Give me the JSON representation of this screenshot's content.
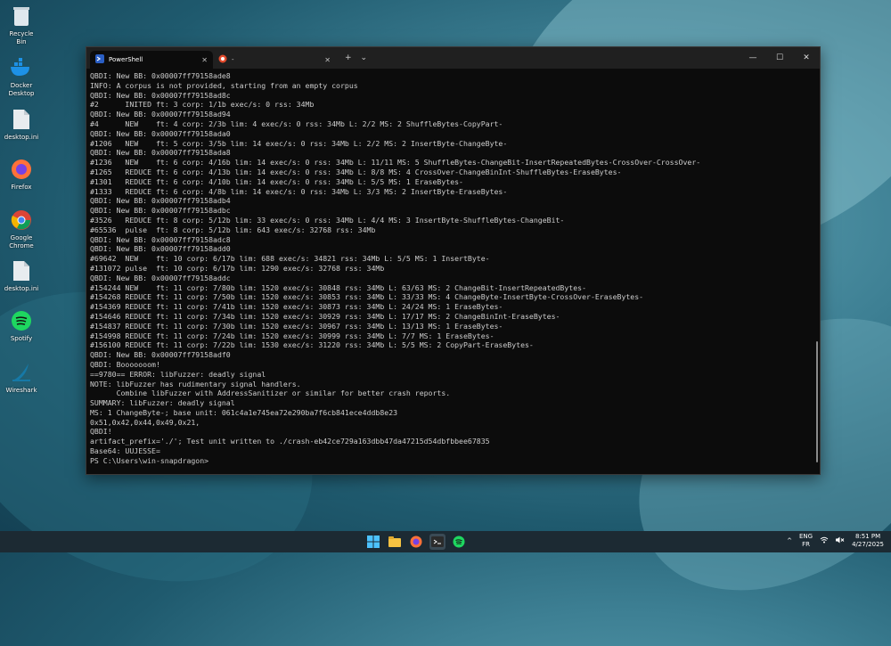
{
  "desktop": {
    "icons": [
      {
        "label": "Recycle Bin",
        "name": "recycle-bin-icon"
      },
      {
        "label": "Docker Desktop",
        "name": "docker-icon"
      },
      {
        "label": "desktop.ini",
        "name": "file-icon"
      },
      {
        "label": "Firefox",
        "name": "firefox-icon"
      },
      {
        "label": "Google Chrome",
        "name": "chrome-icon"
      },
      {
        "label": "desktop.ini",
        "name": "file-icon"
      },
      {
        "label": "Spotify",
        "name": "spotify-icon"
      },
      {
        "label": "Wireshark",
        "name": "wireshark-icon"
      }
    ]
  },
  "terminal": {
    "tabs": [
      {
        "label": "PowerShell",
        "active": true
      },
      {
        "label": "-",
        "active": false
      }
    ],
    "new_tab": "+",
    "dropdown": "⌄",
    "window_controls": {
      "minimize": "—",
      "maximize": "☐",
      "close": "✕"
    },
    "lines": [
      "QBDI: New BB: 0x00007ff79158ade8",
      "INFO: A corpus is not provided, starting from an empty corpus",
      "QBDI: New BB: 0x00007ff79158ad8c",
      "#2      INITED ft: 3 corp: 1/1b exec/s: 0 rss: 34Mb",
      "QBDI: New BB: 0x00007ff79158ad94",
      "#4      NEW    ft: 4 corp: 2/3b lim: 4 exec/s: 0 rss: 34Mb L: 2/2 MS: 2 ShuffleBytes-CopyPart-",
      "QBDI: New BB: 0x00007ff79158ada0",
      "#1206   NEW    ft: 5 corp: 3/5b lim: 14 exec/s: 0 rss: 34Mb L: 2/2 MS: 2 InsertByte-ChangeByte-",
      "QBDI: New BB: 0x00007ff79158ada8",
      "#1236   NEW    ft: 6 corp: 4/16b lim: 14 exec/s: 0 rss: 34Mb L: 11/11 MS: 5 ShuffleBytes-ChangeBit-InsertRepeatedBytes-CrossOver-CrossOver-",
      "#1265   REDUCE ft: 6 corp: 4/13b lim: 14 exec/s: 0 rss: 34Mb L: 8/8 MS: 4 CrossOver-ChangeBinInt-ShuffleBytes-EraseBytes-",
      "#1301   REDUCE ft: 6 corp: 4/10b lim: 14 exec/s: 0 rss: 34Mb L: 5/5 MS: 1 EraseBytes-",
      "#1333   REDUCE ft: 6 corp: 4/8b lim: 14 exec/s: 0 rss: 34Mb L: 3/3 MS: 2 InsertByte-EraseBytes-",
      "QBDI: New BB: 0x00007ff79158adb4",
      "QBDI: New BB: 0x00007ff79158adbc",
      "#3526   REDUCE ft: 8 corp: 5/12b lim: 33 exec/s: 0 rss: 34Mb L: 4/4 MS: 3 InsertByte-ShuffleBytes-ChangeBit-",
      "#65536  pulse  ft: 8 corp: 5/12b lim: 643 exec/s: 32768 rss: 34Mb",
      "QBDI: New BB: 0x00007ff79158adc8",
      "QBDI: New BB: 0x00007ff79158add0",
      "#69642  NEW    ft: 10 corp: 6/17b lim: 688 exec/s: 34821 rss: 34Mb L: 5/5 MS: 1 InsertByte-",
      "#131072 pulse  ft: 10 corp: 6/17b lim: 1290 exec/s: 32768 rss: 34Mb",
      "QBDI: New BB: 0x00007ff79158addc",
      "#154244 NEW    ft: 11 corp: 7/80b lim: 1520 exec/s: 30848 rss: 34Mb L: 63/63 MS: 2 ChangeBit-InsertRepeatedBytes-",
      "#154268 REDUCE ft: 11 corp: 7/50b lim: 1520 exec/s: 30853 rss: 34Mb L: 33/33 MS: 4 ChangeByte-InsertByte-CrossOver-EraseBytes-",
      "#154369 REDUCE ft: 11 corp: 7/41b lim: 1520 exec/s: 30873 rss: 34Mb L: 24/24 MS: 1 EraseBytes-",
      "#154646 REDUCE ft: 11 corp: 7/34b lim: 1520 exec/s: 30929 rss: 34Mb L: 17/17 MS: 2 ChangeBinInt-EraseBytes-",
      "#154837 REDUCE ft: 11 corp: 7/30b lim: 1520 exec/s: 30967 rss: 34Mb L: 13/13 MS: 1 EraseBytes-",
      "#154998 REDUCE ft: 11 corp: 7/24b lim: 1520 exec/s: 30999 rss: 34Mb L: 7/7 MS: 1 EraseBytes-",
      "#156100 REDUCE ft: 11 corp: 7/22b lim: 1530 exec/s: 31220 rss: 34Mb L: 5/5 MS: 2 CopyPart-EraseBytes-",
      "QBDI: New BB: 0x00007ff79158adf0",
      "QBDI: Booooooom!",
      "==9780== ERROR: libFuzzer: deadly signal",
      "NOTE: libFuzzer has rudimentary signal handlers.",
      "      Combine libFuzzer with AddressSanitizer or similar for better crash reports.",
      "SUMMARY: libFuzzer: deadly signal",
      "MS: 1 ChangeByte-; base unit: 061c4a1e745ea72e290ba7f6cb841ece4ddb8e23",
      "0x51,0x42,0x44,0x49,0x21,",
      "QBDI!",
      "artifact_prefix='./'; Test unit written to ./crash-eb42ce729a163dbb47da47215d54dbfbbee67835",
      "Base64: UUJESSE=",
      "PS C:\\Users\\win-snapdragon>"
    ]
  },
  "taskbar": {
    "apps": [
      "windows-start-icon",
      "search-icon",
      "file-explorer-icon",
      "firefox-icon",
      "terminal-icon",
      "spotify-icon"
    ],
    "lang_top": "ENG",
    "lang_bottom": "FR",
    "time": "8:51 PM",
    "date": "4/27/2025",
    "chevron": "^"
  },
  "colors": {
    "terminal_bg": "#0c0c0c",
    "terminal_text": "#cccccc",
    "titlebar": "#202020"
  }
}
